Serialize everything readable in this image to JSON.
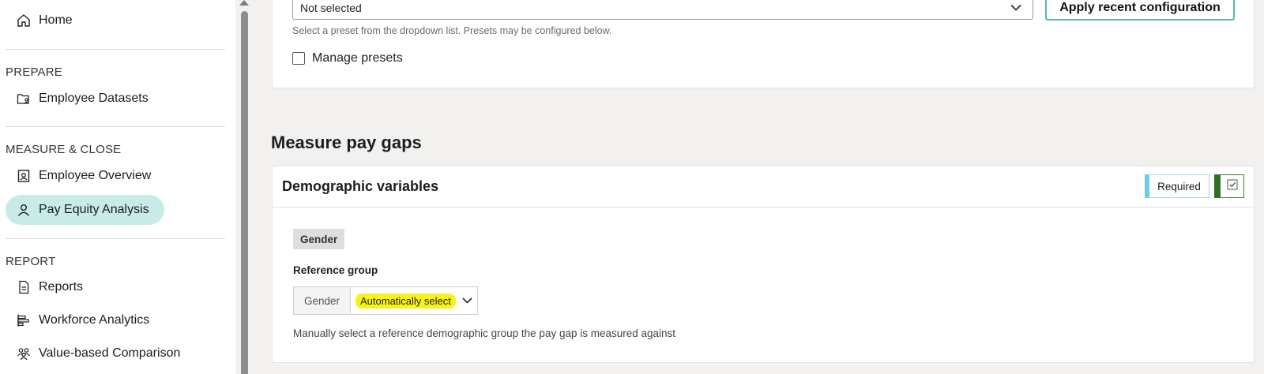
{
  "sidebar": {
    "home": "Home",
    "sections": [
      {
        "heading": "PREPARE",
        "items": [
          "Employee Datasets"
        ]
      },
      {
        "heading": "MEASURE & CLOSE",
        "items": [
          "Employee Overview",
          "Pay Equity Analysis"
        ]
      },
      {
        "heading": "REPORT",
        "items": [
          "Reports",
          "Workforce Analytics",
          "Value-based Comparison"
        ]
      }
    ],
    "active_item": "Pay Equity Analysis"
  },
  "presets": {
    "select_value": "Not selected",
    "apply_button": "Apply recent configuration",
    "helper_text": "Select a preset from the dropdown list. Presets may be configured below.",
    "manage_label": "Manage presets",
    "manage_checked": false
  },
  "measure": {
    "section_title": "Measure pay gaps",
    "card_title": "Demographic variables",
    "required_label": "Required",
    "variable_tag": "Gender",
    "reference_label": "Reference group",
    "reference_prefix": "Gender",
    "reference_value": "Automatically select",
    "reference_help": "Manually select a reference demographic group the pay gap is measured against"
  },
  "colors": {
    "active_nav": "#c9ebe8",
    "accent_teal": "#5cb8ad",
    "required_blue": "#6ecbea",
    "check_green": "#2f6e28",
    "highlight": "#f7f21a"
  },
  "icons": {
    "home": "home-icon",
    "datasets": "folder-user-icon",
    "overview": "id-badge-icon",
    "pay_equity": "user-icon",
    "reports": "document-icon",
    "workforce": "bar-chart-icon",
    "value_comparison": "group-icon"
  }
}
